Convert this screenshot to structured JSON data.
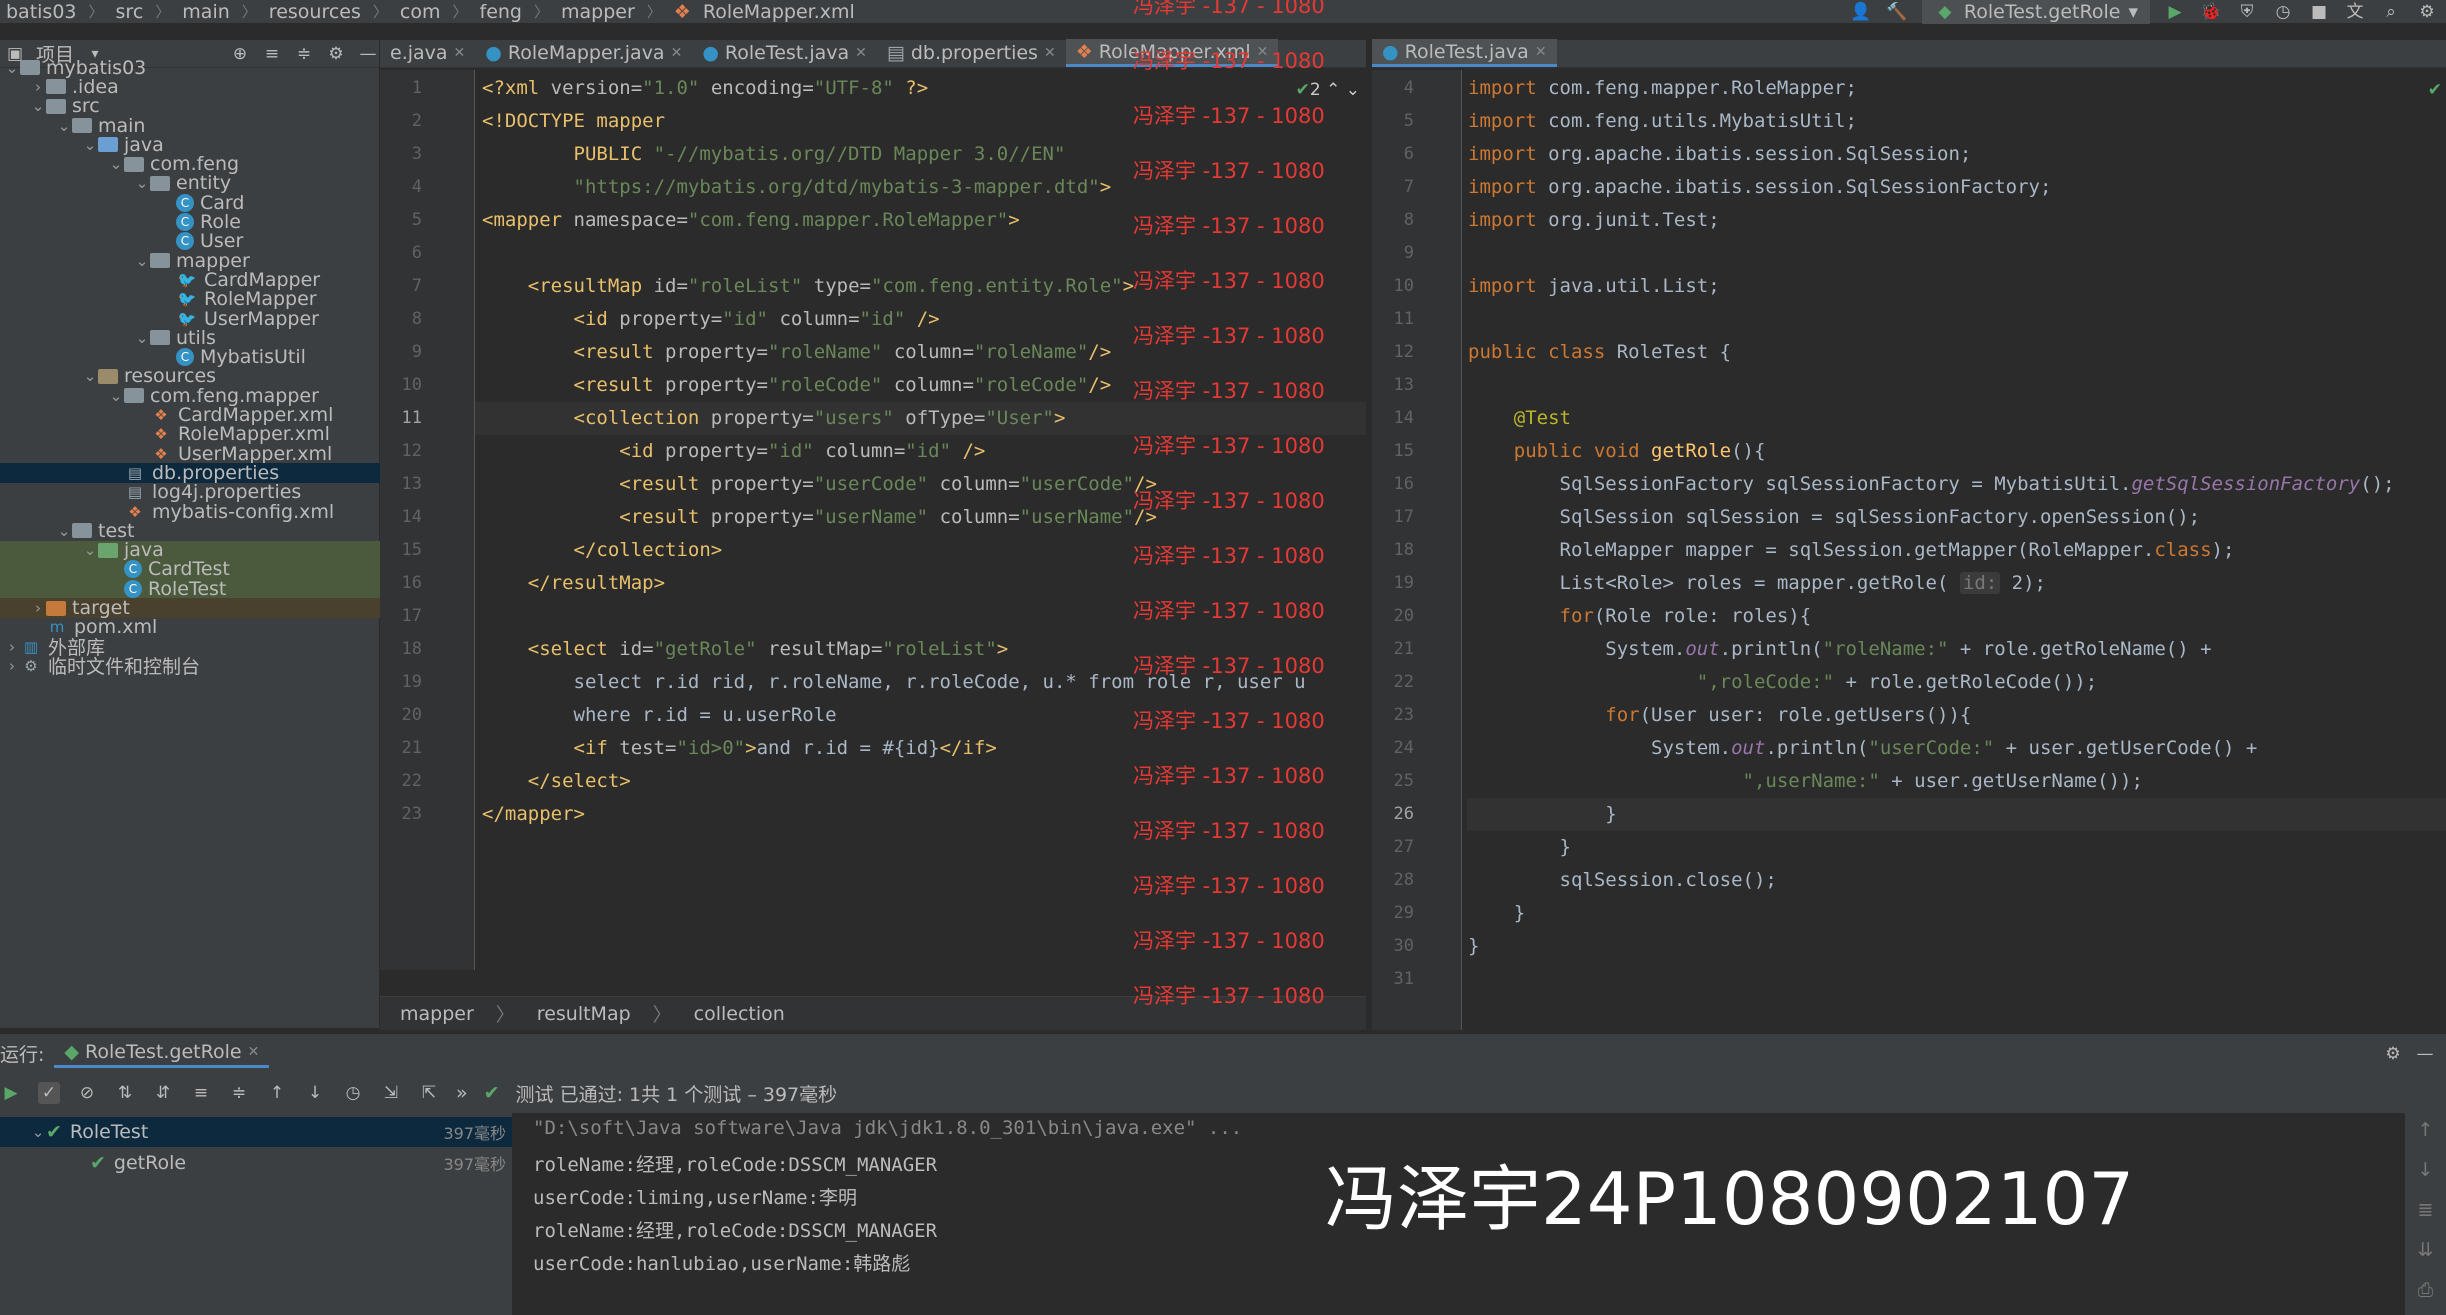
{
  "breadcrumb": {
    "items": [
      "batis03",
      "src",
      "main",
      "resources",
      "com",
      "feng",
      "mapper",
      "RoleMapper.xml"
    ]
  },
  "toolbar": {
    "run_config": "RoleTest.getRole"
  },
  "project_panel": {
    "title": "项目",
    "tree": [
      {
        "label": "mybatis03",
        "depth": 0,
        "icon": "folder",
        "arrow": "down"
      },
      {
        "label": ".idea",
        "depth": 1,
        "icon": "folder",
        "arrow": "right"
      },
      {
        "label": "src",
        "depth": 1,
        "icon": "folder",
        "arrow": "down"
      },
      {
        "label": "main",
        "depth": 2,
        "icon": "folder",
        "arrow": "down"
      },
      {
        "label": "java",
        "depth": 3,
        "icon": "folder-src",
        "arrow": "down"
      },
      {
        "label": "com.feng",
        "depth": 4,
        "icon": "folder",
        "arrow": "down"
      },
      {
        "label": "entity",
        "depth": 5,
        "icon": "folder",
        "arrow": "down"
      },
      {
        "label": "Card",
        "depth": 6,
        "icon": "class",
        "arrow": ""
      },
      {
        "label": "Role",
        "depth": 6,
        "icon": "class",
        "arrow": ""
      },
      {
        "label": "User",
        "depth": 6,
        "icon": "class",
        "arrow": ""
      },
      {
        "label": "mapper",
        "depth": 5,
        "icon": "folder",
        "arrow": "down"
      },
      {
        "label": "CardMapper",
        "depth": 6,
        "icon": "mapper",
        "arrow": ""
      },
      {
        "label": "RoleMapper",
        "depth": 6,
        "icon": "mapper",
        "arrow": ""
      },
      {
        "label": "UserMapper",
        "depth": 6,
        "icon": "mapper",
        "arrow": ""
      },
      {
        "label": "utils",
        "depth": 5,
        "icon": "folder",
        "arrow": "down"
      },
      {
        "label": "MybatisUtil",
        "depth": 6,
        "icon": "class",
        "arrow": ""
      },
      {
        "label": "resources",
        "depth": 3,
        "icon": "folder-res",
        "arrow": "down"
      },
      {
        "label": "com.feng.mapper",
        "depth": 4,
        "icon": "folder",
        "arrow": "down"
      },
      {
        "label": "CardMapper.xml",
        "depth": 5,
        "icon": "xml",
        "arrow": ""
      },
      {
        "label": "RoleMapper.xml",
        "depth": 5,
        "icon": "xml",
        "arrow": ""
      },
      {
        "label": "UserMapper.xml",
        "depth": 5,
        "icon": "xml",
        "arrow": ""
      },
      {
        "label": "db.properties",
        "depth": 4,
        "icon": "props",
        "arrow": "",
        "state": "sel"
      },
      {
        "label": "log4j.properties",
        "depth": 4,
        "icon": "props",
        "arrow": ""
      },
      {
        "label": "mybatis-config.xml",
        "depth": 4,
        "icon": "xml",
        "arrow": ""
      },
      {
        "label": "test",
        "depth": 2,
        "icon": "folder",
        "arrow": "down"
      },
      {
        "label": "java",
        "depth": 3,
        "icon": "folder-test",
        "arrow": "down",
        "state": "selgreen"
      },
      {
        "label": "CardTest",
        "depth": 4,
        "icon": "class",
        "arrow": "",
        "state": "selgreen"
      },
      {
        "label": "RoleTest",
        "depth": 4,
        "icon": "class",
        "arrow": "",
        "state": "selgreen"
      },
      {
        "label": "target",
        "depth": 1,
        "icon": "folder-target",
        "arrow": "right",
        "state": "selbrown"
      },
      {
        "label": "pom.xml",
        "depth": 1,
        "icon": "maven",
        "arrow": ""
      },
      {
        "label": "外部库",
        "depth": 0,
        "icon": "lib",
        "arrow": "right"
      },
      {
        "label": "临时文件和控制台",
        "depth": 0,
        "icon": "scratch",
        "arrow": "right"
      }
    ]
  },
  "editor_left": {
    "tabs": [
      "e.java",
      "RoleMapper.java",
      "RoleTest.java",
      "db.properties",
      "RoleMapper.xml"
    ],
    "active_tab": 4,
    "problems": "2",
    "breadcrumb": [
      "mapper",
      "resultMap",
      "collection"
    ],
    "current_line": 11,
    "lines": [
      [
        [
          "<?",
          "tag"
        ],
        [
          "xml ",
          "tag"
        ],
        [
          "version=",
          "attr"
        ],
        [
          "\"1.0\"",
          "str"
        ],
        [
          " encoding=",
          "attr"
        ],
        [
          "\"UTF-8\"",
          "str"
        ],
        [
          " ?>",
          "tag"
        ]
      ],
      [
        [
          "<!DOCTYPE ",
          "tag"
        ],
        [
          "mapper",
          "tag"
        ]
      ],
      [
        [
          "        PUBLIC ",
          "tag"
        ],
        [
          "\"-//mybatis.org//DTD Mapper 3.0//EN\"",
          "str"
        ]
      ],
      [
        [
          "        ",
          "tag"
        ],
        [
          "\"https://mybatis.org/dtd/mybatis-3-mapper.dtd\"",
          "str"
        ],
        [
          ">",
          "tag"
        ]
      ],
      [
        [
          "<mapper ",
          "tag"
        ],
        [
          "namespace=",
          "attr"
        ],
        [
          "\"com.feng.mapper.RoleMapper\"",
          "str"
        ],
        [
          ">",
          "tag"
        ]
      ],
      [
        [
          "",
          ""
        ]
      ],
      [
        [
          "    <resultMap ",
          "tag"
        ],
        [
          "id=",
          "attr"
        ],
        [
          "\"roleList\"",
          "str"
        ],
        [
          " type=",
          "attr"
        ],
        [
          "\"com.feng.entity.Role\"",
          "str"
        ],
        [
          ">",
          "tag"
        ]
      ],
      [
        [
          "        <id ",
          "tag"
        ],
        [
          "property=",
          "attr"
        ],
        [
          "\"id\"",
          "str"
        ],
        [
          " column=",
          "attr"
        ],
        [
          "\"id\"",
          "str"
        ],
        [
          " />",
          "tag"
        ]
      ],
      [
        [
          "        <result ",
          "tag"
        ],
        [
          "property=",
          "attr"
        ],
        [
          "\"roleName\"",
          "str"
        ],
        [
          " column=",
          "attr"
        ],
        [
          "\"roleName\"",
          "str"
        ],
        [
          "/>",
          "tag"
        ]
      ],
      [
        [
          "        <result ",
          "tag"
        ],
        [
          "property=",
          "attr"
        ],
        [
          "\"roleCode\"",
          "str"
        ],
        [
          " column=",
          "attr"
        ],
        [
          "\"roleCode\"",
          "str"
        ],
        [
          "/>",
          "tag"
        ]
      ],
      [
        [
          "        <collection ",
          "tag"
        ],
        [
          "property=",
          "attr"
        ],
        [
          "\"users\"",
          "str"
        ],
        [
          " ofType=",
          "attr"
        ],
        [
          "\"User\"",
          "str"
        ],
        [
          ">",
          "tag"
        ]
      ],
      [
        [
          "            <id ",
          "tag"
        ],
        [
          "property=",
          "attr"
        ],
        [
          "\"id\"",
          "str"
        ],
        [
          " column=",
          "attr"
        ],
        [
          "\"id\"",
          "str"
        ],
        [
          " />",
          "tag"
        ]
      ],
      [
        [
          "            <result ",
          "tag"
        ],
        [
          "property=",
          "attr"
        ],
        [
          "\"userCode\"",
          "str"
        ],
        [
          " column=",
          "attr"
        ],
        [
          "\"userCode\"",
          "str"
        ],
        [
          "/>",
          "tag"
        ]
      ],
      [
        [
          "            <result ",
          "tag"
        ],
        [
          "property=",
          "attr"
        ],
        [
          "\"userName\"",
          "str"
        ],
        [
          " column=",
          "attr"
        ],
        [
          "\"userName\"",
          "str"
        ],
        [
          "/>",
          "tag"
        ]
      ],
      [
        [
          "        </collection>",
          "tag"
        ]
      ],
      [
        [
          "    </resultMap>",
          "tag"
        ]
      ],
      [
        [
          "",
          ""
        ]
      ],
      [
        [
          "    <select ",
          "tag"
        ],
        [
          "id=",
          "attr"
        ],
        [
          "\"getRole\"",
          "str"
        ],
        [
          " resultMap=",
          "attr"
        ],
        [
          "\"roleList\"",
          "str"
        ],
        [
          ">",
          "tag"
        ]
      ],
      [
        [
          "        select r.id rid, r.roleName, r.roleCode, u.* from role r, user u",
          ""
        ]
      ],
      [
        [
          "        where r.id = u.userRole",
          ""
        ]
      ],
      [
        [
          "        <if ",
          "tag"
        ],
        [
          "test=",
          "attr"
        ],
        [
          "\"id>0\"",
          "str"
        ],
        [
          ">",
          "tag"
        ],
        [
          "and r.id = #{id}",
          ""
        ],
        [
          "</if>",
          "tag"
        ]
      ],
      [
        [
          "    </select>",
          "tag"
        ]
      ],
      [
        [
          "</mapper>",
          "tag"
        ]
      ]
    ]
  },
  "editor_right": {
    "tabs": [
      "RoleTest.java"
    ],
    "first_line": 4,
    "current_line": 26,
    "lines": [
      [
        [
          "import ",
          "kw"
        ],
        [
          "com.feng.mapper.RoleMapper;",
          ""
        ]
      ],
      [
        [
          "import ",
          "kw"
        ],
        [
          "com.feng.utils.MybatisUtil;",
          ""
        ]
      ],
      [
        [
          "import ",
          "kw"
        ],
        [
          "org.apache.ibatis.session.SqlSession;",
          ""
        ]
      ],
      [
        [
          "import ",
          "kw"
        ],
        [
          "org.apache.ibatis.session.SqlSessionFactory;",
          ""
        ]
      ],
      [
        [
          "import ",
          "kw"
        ],
        [
          "org.junit.",
          ""
        ],
        [
          "Test",
          ""
        ],
        [
          ";",
          ""
        ]
      ],
      [
        [
          "",
          ""
        ]
      ],
      [
        [
          "import ",
          "kw"
        ],
        [
          "java.util.List;",
          ""
        ]
      ],
      [
        [
          "",
          ""
        ]
      ],
      [
        [
          "public class ",
          "kw"
        ],
        [
          "RoleTest {",
          ""
        ]
      ],
      [
        [
          "",
          ""
        ]
      ],
      [
        [
          "    @Test",
          "ann"
        ]
      ],
      [
        [
          "    public void ",
          "kw"
        ],
        [
          "getRole",
          "fn"
        ],
        [
          "(){",
          ""
        ]
      ],
      [
        [
          "        SqlSessionFactory sqlSessionFactory = MybatisUtil.",
          ""
        ],
        [
          "getSqlSessionFactory",
          "it"
        ],
        [
          "();",
          ""
        ]
      ],
      [
        [
          "        SqlSession sqlSession = sqlSessionFactory.openSession();",
          ""
        ]
      ],
      [
        [
          "        RoleMapper mapper = sqlSession.getMapper(RoleMapper.",
          ""
        ],
        [
          "class",
          "kw"
        ],
        [
          ");",
          ""
        ]
      ],
      [
        [
          "        List<Role> roles = mapper.getRole( ",
          ""
        ],
        [
          "id:",
          "hint"
        ],
        [
          " 2);",
          ""
        ]
      ],
      [
        [
          "        ",
          ""
        ],
        [
          "for",
          "kw"
        ],
        [
          "(Role role: roles){",
          ""
        ]
      ],
      [
        [
          "            System.",
          ""
        ],
        [
          "out",
          "it"
        ],
        [
          ".println(",
          ""
        ],
        [
          "\"roleName:\"",
          "str"
        ],
        [
          " + role.getRoleName() +",
          ""
        ]
      ],
      [
        [
          "                    ",
          ""
        ],
        [
          "\",roleCode:\"",
          "str"
        ],
        [
          " + role.getRoleCode());",
          ""
        ]
      ],
      [
        [
          "            ",
          ""
        ],
        [
          "for",
          "kw"
        ],
        [
          "(User user: role.getUsers()){",
          ""
        ]
      ],
      [
        [
          "                System.",
          ""
        ],
        [
          "out",
          "it"
        ],
        [
          ".println(",
          ""
        ],
        [
          "\"userCode:\"",
          "str"
        ],
        [
          " + user.getUserCode() +",
          ""
        ]
      ],
      [
        [
          "                        ",
          ""
        ],
        [
          "\",userName:\"",
          "str"
        ],
        [
          " + user.getUserName());",
          ""
        ]
      ],
      [
        [
          "            }",
          ""
        ]
      ],
      [
        [
          "        }",
          ""
        ]
      ],
      [
        [
          "        sqlSession.close();",
          ""
        ]
      ],
      [
        [
          "    }",
          ""
        ]
      ],
      [
        [
          "}",
          ""
        ]
      ],
      [
        [
          "",
          ""
        ]
      ]
    ]
  },
  "watermark": {
    "small": "冯泽宇 -137 - 1080",
    "big": "冯泽宇24P1080902107"
  },
  "run_panel": {
    "label": "运行:",
    "tab": "RoleTest.getRole",
    "status": "测试 已通过: 1共 1 个测试 – 397毫秒",
    "tree": [
      {
        "label": "RoleTest",
        "time": "397毫秒"
      },
      {
        "label": "getRole",
        "time": "397毫秒"
      }
    ],
    "console": [
      "\"D:\\soft\\Java software\\Java jdk\\jdk1.8.0_301\\bin\\java.exe\" ...",
      "roleName:经理,roleCode:DSSCM_MANAGER",
      "userCode:liming,userName:李明",
      "roleName:经理,roleCode:DSSCM_MANAGER",
      "userCode:hanlubiao,userName:韩路彪"
    ]
  },
  "colors": {
    "accent": "#4a88c7",
    "pass": "#59a869",
    "watermark": "#e53935"
  }
}
